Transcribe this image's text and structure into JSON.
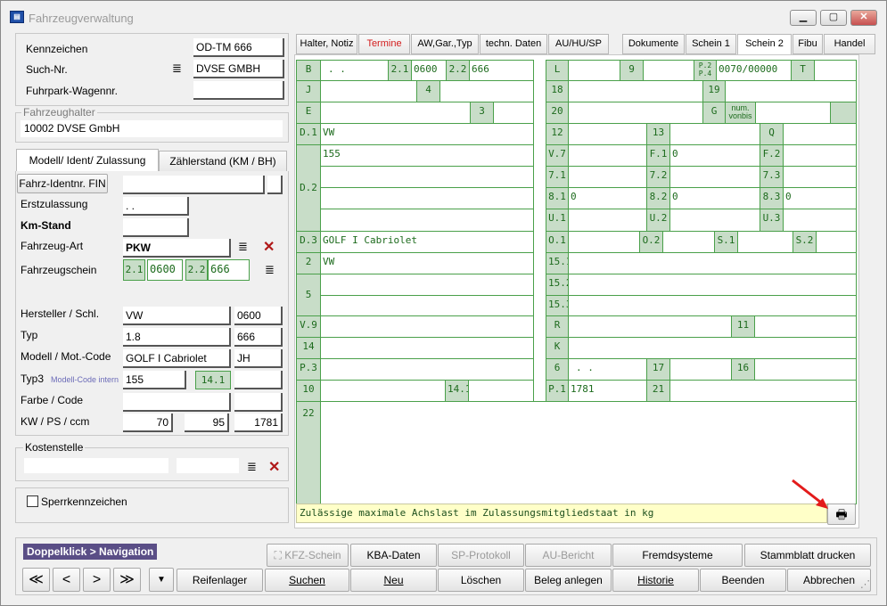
{
  "window": {
    "title": "Fahrzeugverwaltung",
    "app_icon": "car-app-icon"
  },
  "header": {
    "kennzeichen_label": "Kennzeichen",
    "kennzeichen_value": "OD-TM 666",
    "suchnr_label": "Such-Nr.",
    "suchnr_value": "DVSE GMBH",
    "fuhrpark_label": "Fuhrpark-Wagennr.",
    "fuhrpark_value": ""
  },
  "halter": {
    "group_title": "Fahrzeughalter",
    "value": "10002 DVSE GmbH"
  },
  "left_tabs": [
    {
      "label": "Modell/ Ident/ Zulassung"
    },
    {
      "label": "Zählerstand (KM / BH)"
    }
  ],
  "ident": {
    "fin_button": "Fahrz-Identnr. FIN",
    "fin_value": "",
    "erstzul_label": "Erstzulassung",
    "erstzul_value": ". .",
    "kmstand_label": "Km-Stand",
    "kmstand_value": "",
    "art_label": "Fahrzeug-Art",
    "art_value": "PKW",
    "schein_label": "Fahrzeugschein",
    "schein_21": "2.1",
    "schein_21_val": "0600",
    "schein_22": "2.2",
    "schein_22_val": "666",
    "hersteller_label": "Hersteller / Schl.",
    "hersteller_value": "VW",
    "hersteller_code": "0600",
    "typ_label": "Typ",
    "typ_value": "1.8",
    "typ_code": "666",
    "modell_label": "Modell / Mot.-Code",
    "modell_value": "GOLF I Cabriolet",
    "motcode": "JH",
    "typ3_label": "Typ3",
    "typ3_sub": "Modell-Code intern",
    "typ3_value": "155",
    "typ3_box": "14.1",
    "typ3_code": "",
    "farbe_label": "Farbe / Code",
    "farbe_value": "",
    "farbe_code": "",
    "kw_label": "KW / PS / ccm",
    "kw": "70",
    "ps": "95",
    "ccm": "1781"
  },
  "kosten": {
    "group_title": "Kostenstelle",
    "value1": "",
    "value2": ""
  },
  "sperr": {
    "label": "Sperrkennzeichen",
    "checked": false
  },
  "right_tabs": [
    {
      "label": "Halter, Notiz"
    },
    {
      "label": "Termine",
      "color": "#d11a1a"
    },
    {
      "label": "AW,Gar.,Typ"
    },
    {
      "label": "techn. Daten"
    },
    {
      "label": "AU/HU/SP"
    },
    {
      "label": "Dokumente"
    },
    {
      "label": "Schein 1"
    },
    {
      "label": "Schein 2",
      "selected": true
    },
    {
      "label": "Fibu"
    },
    {
      "label": "Handel"
    }
  ],
  "schein2": {
    "B": "B",
    "B_val": ". .",
    "c21": "2.1",
    "c21v": "0600",
    "c22": "2.2",
    "c22v": "666",
    "J": "J",
    "c4": "4",
    "E": "E",
    "c3": "3",
    "D1": "D.1",
    "D1v": "VW",
    "D2": "D.2",
    "D2v": "155",
    "D3": "D.3",
    "D3v": "GOLF I Cabriolet",
    "c2": "2",
    "c2v": "VW",
    "c5": "5",
    "V9": "V.9",
    "c14": "14",
    "P3": "P.3",
    "c10": "10",
    "c141": "14.1",
    "c22b": "22",
    "L": "L",
    "c9": "9",
    "P2": "P.2",
    "P4": "P.4",
    "P2v": "0070/00000",
    "T": "T",
    "c18": "18",
    "c19": "19",
    "c20": "20",
    "G": "G",
    "num1": "num.",
    "num2": "vonbis",
    "c12": "12",
    "c13": "13",
    "Q": "Q",
    "V7": "V.7",
    "F1": "F.1",
    "F1v": "0",
    "F2": "F.2",
    "c71": "7.1",
    "c72": "7.2",
    "c73": "7.3",
    "c81": "8.1",
    "c81v": "0",
    "c82": "8.2",
    "c82v": "0",
    "c83": "8.3",
    "c83v": "0",
    "U1": "U.1",
    "U2": "U.2",
    "U3": "U.3",
    "O1": "O.1",
    "O2": "O.2",
    "S1": "S.1",
    "S2": "S.2",
    "c151": "15.1",
    "c152": "15.2",
    "c153": "15.3",
    "R": "R",
    "c11": "11",
    "K": "K",
    "c6": "6",
    "c6v": ". .",
    "c17": "17",
    "c16": "16",
    "P1": "P.1",
    "P1v": "1781",
    "c21b": "21",
    "hint": "Zulässige maximale Achslast im Zulassungsmitgliedstaat in kg"
  },
  "bottom": {
    "nav_label": "Doppelklick > Navigation",
    "kfz": "KFZ-Schein",
    "kba": "KBA-Daten",
    "sp": "SP-Protokoll",
    "au": "AU-Bericht",
    "fremd": "Fremdsysteme",
    "stamm": "Stammblatt drucken",
    "reifen": "Reifenlager",
    "suchen": "Suchen",
    "neu": "Neu",
    "loeschen": "Löschen",
    "beleg": "Beleg anlegen",
    "historie": "Historie",
    "beenden": "Beenden",
    "abbrechen": "Abbrechen"
  }
}
